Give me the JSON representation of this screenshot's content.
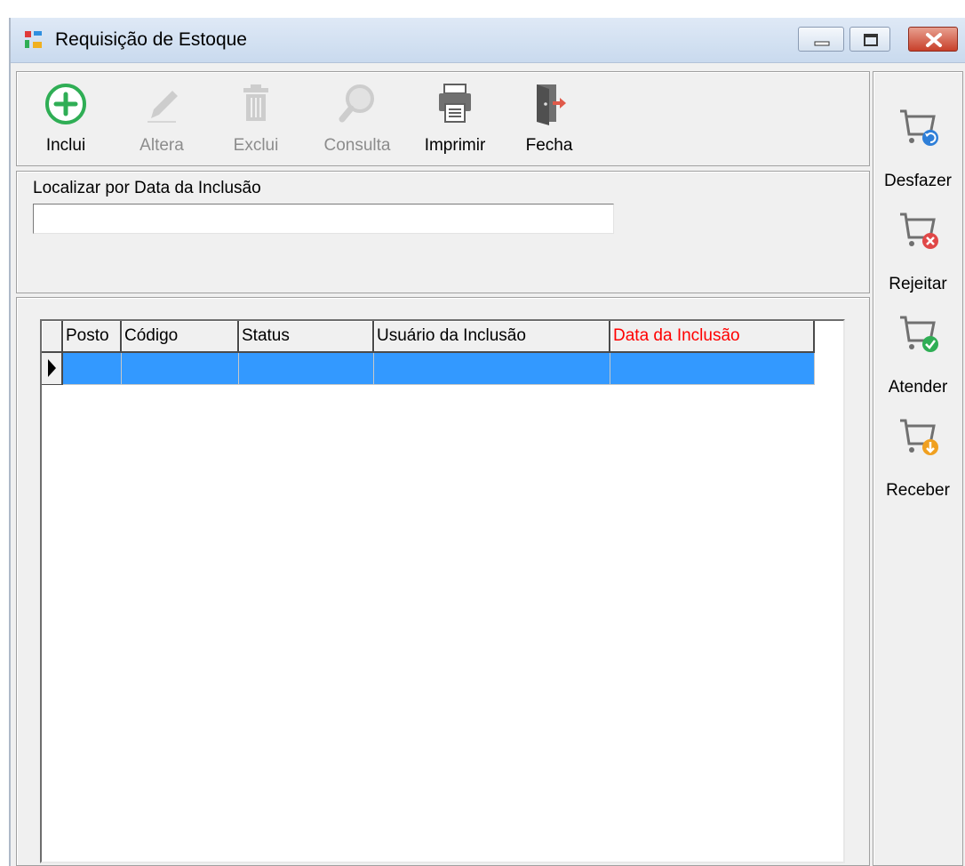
{
  "window": {
    "title": "Requisição de Estoque"
  },
  "toolbar": {
    "items": [
      {
        "label": "Inclui",
        "icon": "plus-circle-icon",
        "enabled": true
      },
      {
        "label": "Altera",
        "icon": "pencil-icon",
        "enabled": false
      },
      {
        "label": "Exclui",
        "icon": "trash-icon",
        "enabled": false
      },
      {
        "label": "Consulta",
        "icon": "magnifier-icon",
        "enabled": false
      },
      {
        "label": "Imprimir",
        "icon": "printer-icon",
        "enabled": true
      },
      {
        "label": "Fecha",
        "icon": "door-exit-icon",
        "enabled": true
      }
    ]
  },
  "search": {
    "label": "Localizar por Data da Inclusão",
    "value": ""
  },
  "grid": {
    "columns": [
      {
        "label": "Posto",
        "highlight": false
      },
      {
        "label": "Código",
        "highlight": false
      },
      {
        "label": "Status",
        "highlight": false
      },
      {
        "label": "Usuário da Inclusão",
        "highlight": false
      },
      {
        "label": "Data da Inclusão",
        "highlight": true
      }
    ],
    "rows": [
      {
        "posto": "",
        "codigo": "",
        "status": "",
        "usuario": "",
        "data": "",
        "selected": true
      }
    ]
  },
  "sidebar": {
    "items": [
      {
        "label": "Desfazer",
        "icon": "cart-undo-icon",
        "badge_color": "#2f7fd8"
      },
      {
        "label": "Rejeitar",
        "icon": "cart-reject-icon",
        "badge_color": "#e04848"
      },
      {
        "label": "Atender",
        "icon": "cart-check-icon",
        "badge_color": "#2fae55"
      },
      {
        "label": "Receber",
        "icon": "cart-receive-icon",
        "badge_color": "#f0a020"
      }
    ]
  },
  "colors": {
    "selection": "#3399ff",
    "highlight_header": "#ff0000",
    "add_icon": "#2fae55"
  }
}
